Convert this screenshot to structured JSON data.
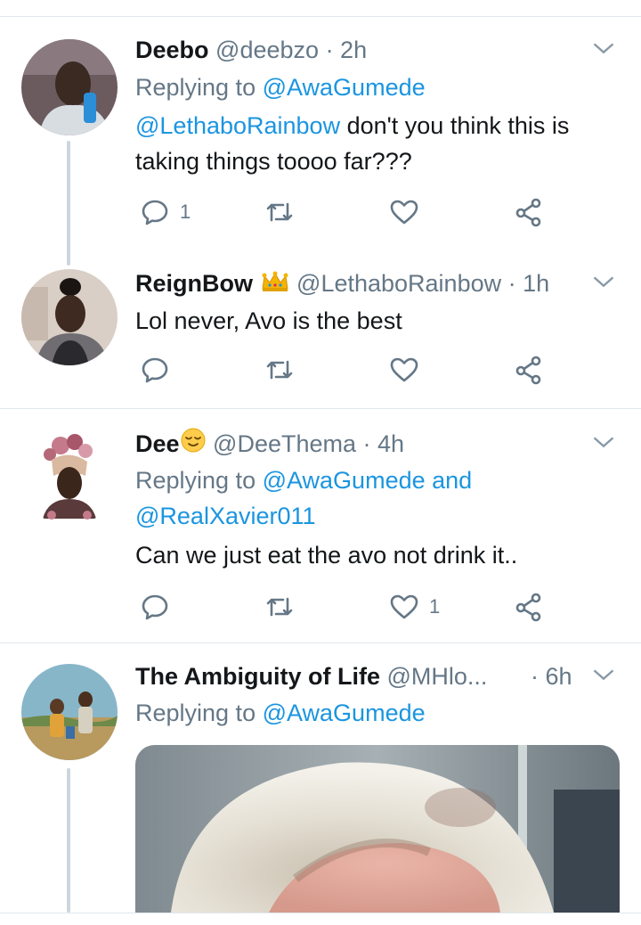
{
  "tweets": [
    {
      "name": "Deebo",
      "handle": "@deebzo",
      "time": "· 2h",
      "replying_prefix": "Replying to",
      "replying_to": "@AwaGumede",
      "mention": "@LethaboRainbow",
      "text1": " don't you think this is",
      "text2": "taking things toooo far???",
      "reply_count": "1",
      "like_count": ""
    },
    {
      "name": "ReignBow",
      "handle": "@LethaboRainbow",
      "time": "· 1h",
      "text": "Lol never, Avo is the best"
    },
    {
      "name": "Dee",
      "handle": "@DeeThema",
      "time": "· 4h",
      "replying_prefix": "Replying to",
      "replying_to": "@AwaGumede",
      "and_text": " and",
      "replying_to2": "@RealXavier011",
      "text": "Can we just eat the avo not drink it..",
      "like_count": "1"
    },
    {
      "name": "The Ambiguity of Life",
      "handle": "@MHlo...",
      "time": "· 6h",
      "replying_prefix": "Replying to",
      "replying_to": "@AwaGumede"
    }
  ],
  "icons": {
    "reply": "reply-icon",
    "retweet": "retweet-icon",
    "like": "heart-icon",
    "share": "share-icon",
    "more": "chevron-down-icon"
  },
  "colors": {
    "link": "#1b95e0",
    "meta": "#657786",
    "divider": "#e1e8ed"
  }
}
